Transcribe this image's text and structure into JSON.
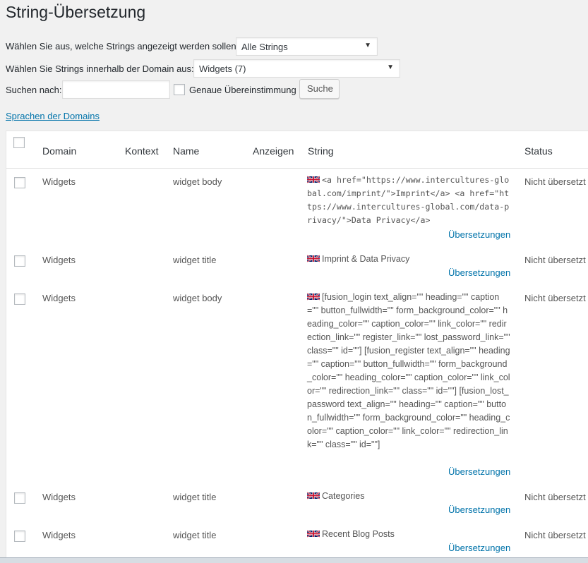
{
  "page_title": "String-Übersetzung",
  "filters": {
    "show_label": "Wählen Sie aus, welche Strings angezeigt werden sollen:",
    "show_value": "Alle Strings",
    "domain_label": "Wählen Sie Strings innerhalb der Domain aus:",
    "domain_value": "Widgets (7)",
    "search_label": "Suchen nach:",
    "search_value": "",
    "exact_match_label": "Genaue Übereinstimmung",
    "search_button": "Suche",
    "domain_languages_link": "Sprachen der Domains"
  },
  "table": {
    "headers": {
      "domain": "Domain",
      "context": "Kontext",
      "name": "Name",
      "view": "Anzeigen",
      "string": "String",
      "status": "Status"
    },
    "rows": [
      {
        "domain": "Widgets",
        "name": "widget body",
        "string": "<a href=\"https://www.intercultures-global.com/imprint/\">Imprint</a> <a href=\"https://www.intercultures-global.com/data-privacy/\">Data Privacy</a>",
        "translations": "Übersetzungen",
        "status": "Nicht übersetzt"
      },
      {
        "domain": "Widgets",
        "name": "widget title",
        "string": "Imprint & Data Privacy",
        "translations": "Übersetzungen",
        "status": "Nicht übersetzt"
      },
      {
        "domain": "Widgets",
        "name": "widget body",
        "string": "[fusion_login text_align=\"\" heading=\"\" caption=\"\" button_fullwidth=\"\" form_background_color=\"\" heading_color=\"\" caption_color=\"\" link_color=\"\" redirection_link=\"\" register_link=\"\" lost_password_link=\"\" class=\"\" id=\"\"] [fusion_register text_align=\"\" heading=\"\" caption=\"\" button_fullwidth=\"\" form_background_color=\"\" heading_color=\"\" caption_color=\"\" link_color=\"\" redirection_link=\"\" class=\"\" id=\"\"] [fusion_lost_password text_align=\"\" heading=\"\" caption=\"\" button_fullwidth=\"\" form_background_color=\"\" heading_color=\"\" caption_color=\"\" link_color=\"\" redirection_link=\"\" class=\"\" id=\"\"]",
        "translations": "Übersetzungen",
        "status": "Nicht übersetzt"
      },
      {
        "domain": "Widgets",
        "name": "widget title",
        "string": "Categories",
        "translations": "Übersetzungen",
        "status": "Nicht übersetzt"
      },
      {
        "domain": "Widgets",
        "name": "widget title",
        "string": "Recent Blog Posts",
        "translations": "Übersetzungen",
        "status": "Nicht übersetzt"
      }
    ]
  },
  "icons": {
    "language_flag": "uk-flag-icon",
    "dropdown": "caret-down-icon"
  },
  "colors": {
    "link": "#0073aa",
    "background": "#f1f1f1"
  }
}
